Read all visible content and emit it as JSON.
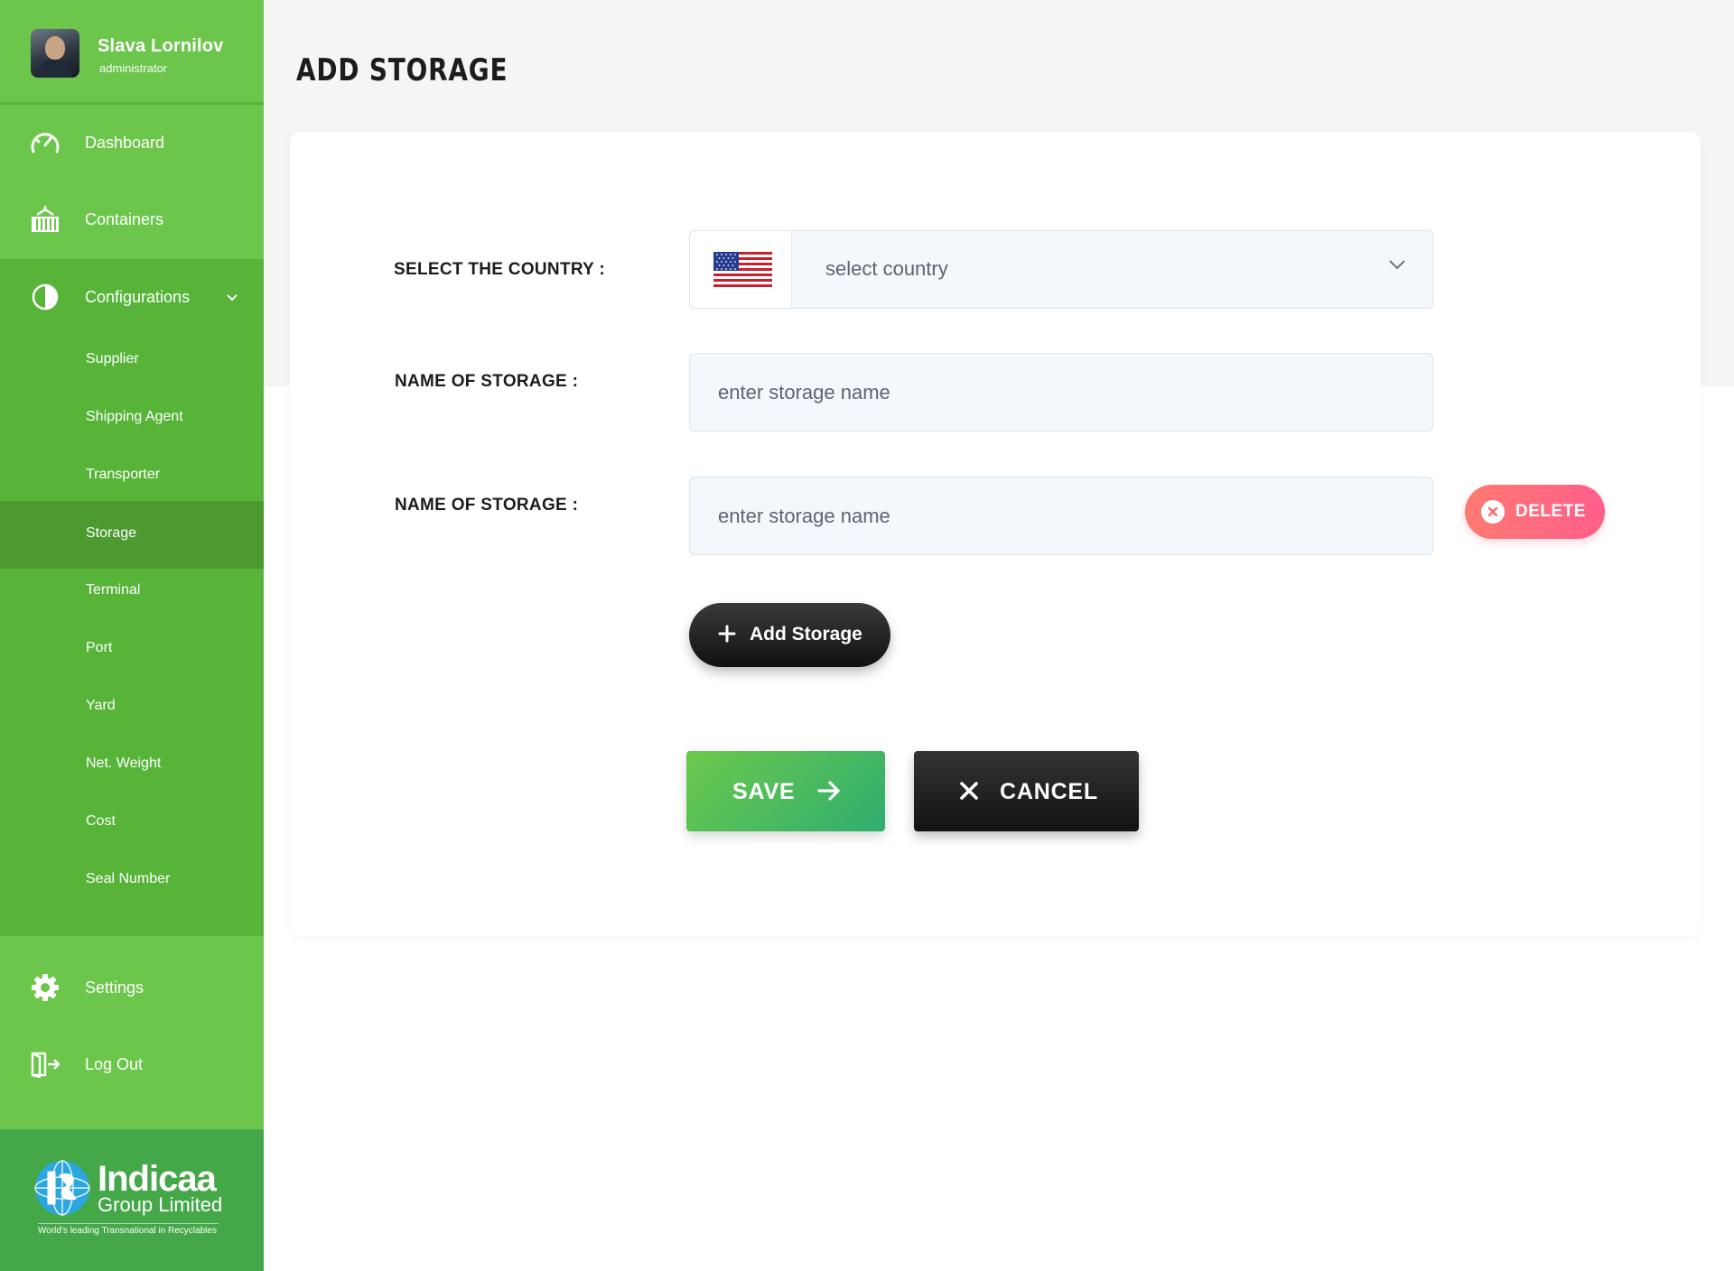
{
  "profile": {
    "name": "Slava Lornilov",
    "role": "administrator"
  },
  "nav": {
    "dashboard": "Dashboard",
    "containers": "Containers",
    "configurations": "Configurations",
    "settings": "Settings",
    "logout": "Log Out"
  },
  "config_items": [
    "Supplier",
    "Shipping Agent",
    "Transporter",
    "Storage",
    "Terminal",
    "Port",
    "Yard",
    "Net. Weight",
    "Cost",
    "Seal Number"
  ],
  "active_config_item": "Storage",
  "logo": {
    "name": "Indicaa",
    "subname": "Group Limited",
    "tagline": "World's leading Transnational in Recyclables"
  },
  "page": {
    "title": "ADD STORAGE"
  },
  "form": {
    "country_label": "SELECT THE COUNTRY :",
    "country_placeholder": "select country",
    "storage_label_1": "NAME OF STORAGE :",
    "storage_placeholder_1": "enter storage name",
    "storage_label_2": "NAME OF STORAGE :",
    "storage_placeholder_2": "enter storage name",
    "delete_label": "DELETE",
    "add_label": "Add Storage",
    "save_label": "SAVE",
    "cancel_label": "CANCEL"
  },
  "colors": {
    "sidebar_green": "#6cc64c",
    "active_green": "#4c9a30",
    "delete_pink": "#ff6a80",
    "save_green": "#3db862",
    "dark": "#1c1c1c"
  },
  "icons": [
    "speedometer-icon",
    "container-icon",
    "contrast-icon",
    "chevron-down-icon",
    "gear-icon",
    "logout-icon",
    "us-flag-icon",
    "close-circle-icon",
    "plus-icon",
    "arrow-right-icon",
    "close-icon"
  ]
}
